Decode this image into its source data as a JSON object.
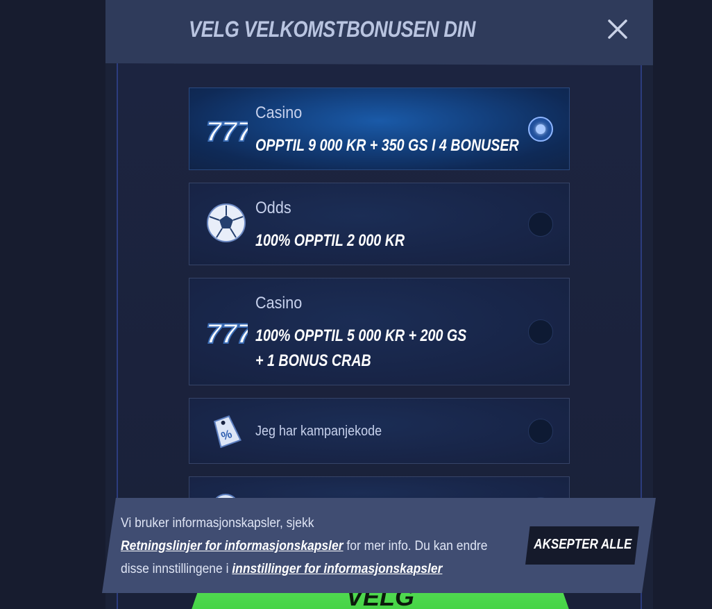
{
  "modal": {
    "title": "VELG VELKOMSTBONUSEN DIN"
  },
  "options": [
    {
      "category": "Casino",
      "offer_line1": "OPPTIL 9 000 KR + 350 GS I 4 BONUSER",
      "icon": "slot-777-icon",
      "selected": true
    },
    {
      "category": "Odds",
      "offer_line1": "100% OPPTIL 2 000 KR",
      "icon": "football-icon",
      "selected": false
    },
    {
      "category": "Casino",
      "offer_line1": "100% OPPTIL 5 000 KR + 200 GS",
      "offer_line2": "+ 1 BONUS CRAB",
      "icon": "slot-777-icon",
      "selected": false
    },
    {
      "label": "Jeg har kampanjekode",
      "icon": "percent-tag-icon",
      "selected": false
    }
  ],
  "primary_button": {
    "label": "VELG"
  },
  "cookie": {
    "text_part1": "Vi bruker informasjonskapsler, sjekk",
    "link1": "Retningslinjer for informasjonskapsler",
    "text_part2": " for mer info. Du kan endre disse innstillingene i ",
    "link2": "innstillinger for informasjonskapsler",
    "accept_label": "AKSEPTER ALLE"
  },
  "colors": {
    "background": "#171c2f",
    "header": "#2f3b5b",
    "selected_option": "#13407e",
    "cta_green": "#4fd94f",
    "cookie_bar": "#404d72"
  }
}
